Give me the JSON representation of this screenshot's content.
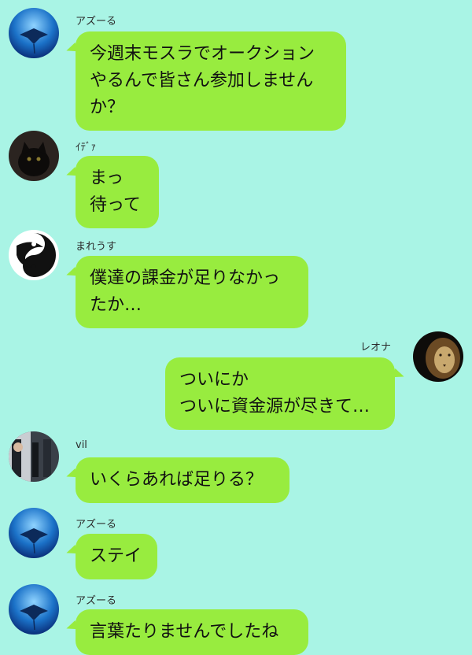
{
  "messages": [
    {
      "sender": "アズーる",
      "text": "今週末モスラでオークション\nやるんで皆さん参加しません\nか？",
      "avatar": "manta-ray-icon",
      "side": "left"
    },
    {
      "sender": "ｲﾃﾞｧ",
      "text": "まっ\n待って",
      "avatar": "black-cat-icon",
      "side": "left"
    },
    {
      "sender": "まれうす",
      "text": "僕達の課金が足りなかっ\nたか…",
      "avatar": "dragon-yinyang-icon",
      "side": "left"
    },
    {
      "sender": "レオナ",
      "text": "ついにか\nついに資金源が尽きて…",
      "avatar": "lion-icon",
      "side": "right"
    },
    {
      "sender": "vil",
      "text": "いくらあれば足りる？",
      "avatar": "person-photo-icon",
      "side": "left"
    },
    {
      "sender": "アズーる",
      "text": "ステイ",
      "avatar": "manta-ray-icon",
      "side": "left"
    },
    {
      "sender": "アズーる",
      "text": "言葉たりませんでしたね",
      "avatar": "manta-ray-icon",
      "side": "left"
    }
  ],
  "colors": {
    "background": "#a9f4e5",
    "bubble": "#98ec3f"
  }
}
